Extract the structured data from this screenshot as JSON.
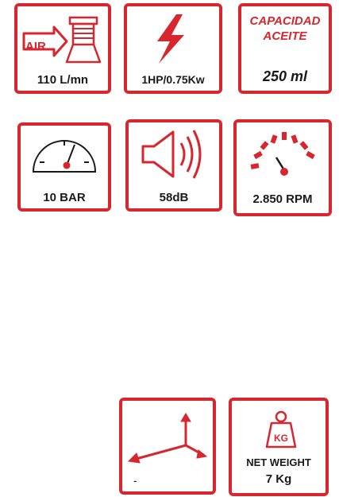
{
  "colors": {
    "accent": "#d7262e",
    "text": "#1a1a1a"
  },
  "cards": [
    {
      "icon": "air-flow-icon",
      "label": "110 L/mn",
      "icon_text": "AIR"
    },
    {
      "icon": "lightning-bolt-icon",
      "label": "1HP/0.75Kw"
    },
    {
      "icon": "oil-capacity-icon",
      "title_line1": "CAPACIDAD",
      "title_line2": "ACEITE",
      "label": "250 ml"
    },
    {
      "icon": "pressure-gauge-icon",
      "label": "10 BAR"
    },
    {
      "icon": "speaker-sound-icon",
      "label": "58dB"
    },
    {
      "icon": "speedometer-icon",
      "label": "2.850 RPM"
    },
    {
      "icon": "dimensions-axes-icon",
      "label": "-"
    },
    {
      "icon": "weight-icon",
      "icon_text": "KG",
      "title_line1": "NET WEIGHT",
      "label": "7 Kg"
    }
  ]
}
